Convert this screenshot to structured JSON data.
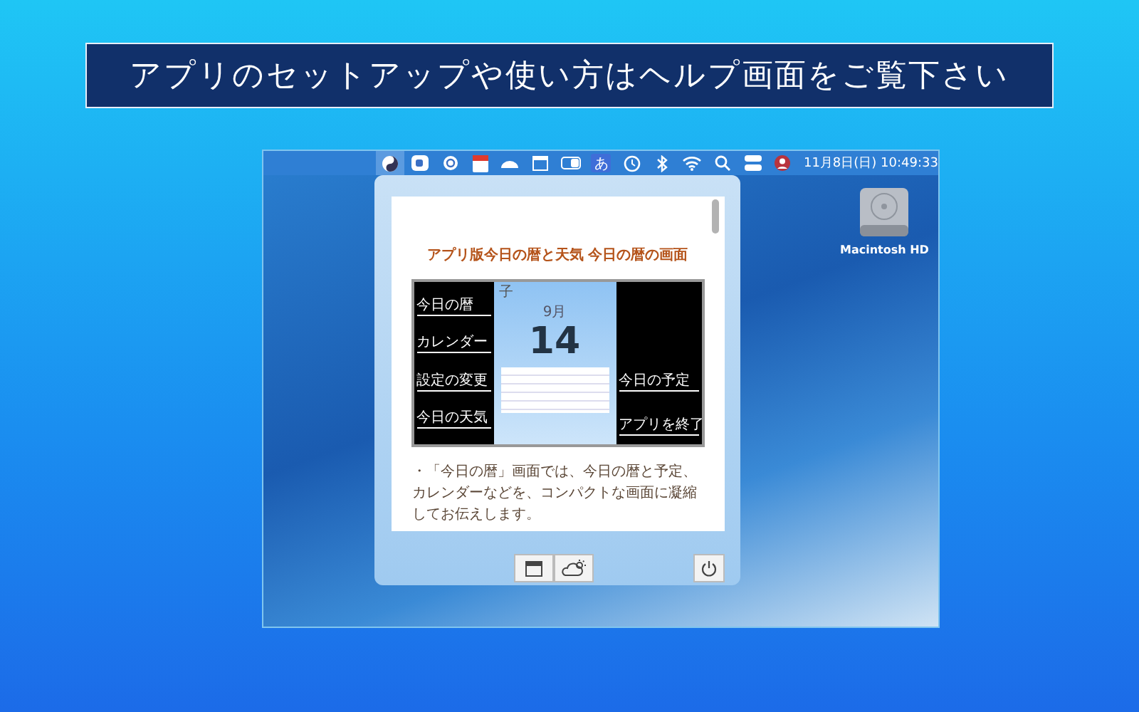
{
  "banner": {
    "text": "アプリのセットアップや使い方はヘルプ画面をご覧下さい"
  },
  "menu_bar": {
    "input_method": "あ",
    "clock": "11月8日(日) 10:49:33"
  },
  "desktop": {
    "drive_label": "Macintosh HD"
  },
  "popover": {
    "document": {
      "title": "アプリ版今日の暦と天気 今日の暦の画面",
      "figure": {
        "left_labels": [
          "今日の暦",
          "カレンダー",
          "設定の変更",
          "今日の天気"
        ],
        "right_labels": [
          "今日の予定",
          "アプリを終了"
        ],
        "zodiac": "子",
        "month": "9月",
        "day": "14"
      },
      "body": "・「今日の暦」画面では、今日の暦と予定、カレンダーなどを、コンパクトな画面に凝縮してお伝えします。"
    }
  }
}
